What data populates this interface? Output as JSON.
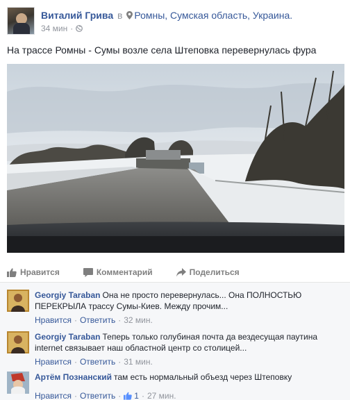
{
  "post": {
    "author": "Виталий Грива",
    "in_word": "в",
    "location": "Ромны, Сумская область, Украина.",
    "time": "34 мин",
    "text": "На трассе Ромны - Сумы возле села Штеповка перевернулась фура"
  },
  "actions": {
    "like": "Нравится",
    "comment": "Комментарий",
    "share": "Поделиться"
  },
  "comments": [
    {
      "author": "Georgiy Taraban",
      "text": "Она не просто перевернулась... Она ПОЛНОСТЬЮ ПЕРЕКРЫЛА трассу Сумы-Киев. Между прочим...",
      "like": "Нравится",
      "reply": "Ответить",
      "time": "32 мин."
    },
    {
      "author": "Georgiy Taraban",
      "text": "Теперь только голубиная почта да вездесущая паутина internet связывает наш областной центр со столицей...",
      "like": "Нравится",
      "reply": "Ответить",
      "time": "31 мин."
    },
    {
      "author": "Артём Познанский",
      "text": "там есть нормальный объезд через Штеповку",
      "like": "Нравится",
      "reply": "Ответить",
      "likes_count": "1",
      "time": "27 мин."
    }
  ],
  "colors": {
    "link": "#365899",
    "muted": "#90949c",
    "comments_bg": "#f6f7f9"
  },
  "icons": [
    "pin-icon",
    "globe-icon",
    "thumbs-up-icon",
    "comment-icon",
    "share-icon"
  ]
}
